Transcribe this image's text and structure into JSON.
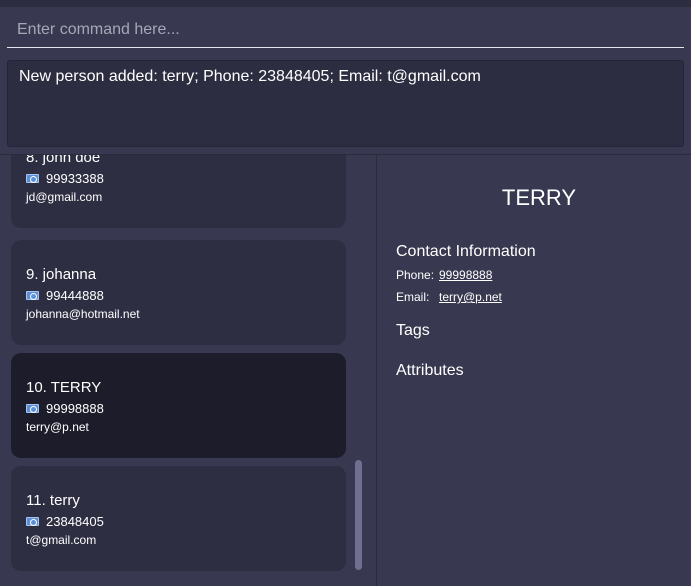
{
  "command": {
    "placeholder": "Enter command here...",
    "value": ""
  },
  "result": {
    "text": "New person added: terry; Phone: 23848405; Email: t@gmail.com"
  },
  "persons": [
    {
      "index_name": "8. john doe",
      "phone": "99933388",
      "email": "jd@gmail.com",
      "selected": false
    },
    {
      "index_name": "9. johanna",
      "phone": "99444888",
      "email": "johanna@hotmail.net",
      "selected": false
    },
    {
      "index_name": "10. TERRY",
      "phone": "99998888",
      "email": "terry@p.net",
      "selected": true
    },
    {
      "index_name": "11. terry",
      "phone": "23848405",
      "email": "t@gmail.com",
      "selected": false
    }
  ],
  "detail": {
    "name": "TERRY",
    "contact_heading": "Contact Information",
    "phone_label": "Phone:",
    "phone": "99998888",
    "email_label": "Email:",
    "email": "terry@p.net",
    "tags_heading": "Tags",
    "attributes_heading": "Attributes"
  },
  "colors": {
    "background": "#383950",
    "card": "#2d2e42",
    "card_selected": "#1c1c2a",
    "result_box": "#2c2d40"
  }
}
